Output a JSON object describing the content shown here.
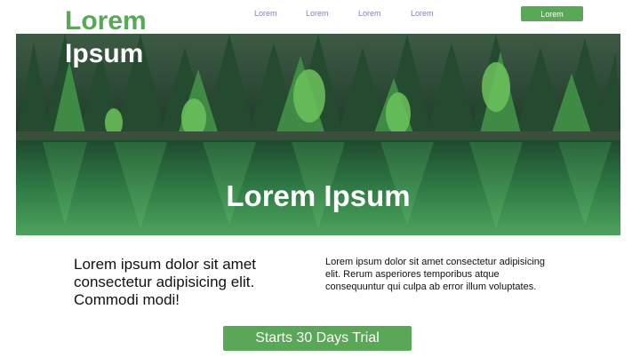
{
  "header": {
    "logo_line1": "Lorem",
    "logo_line2": "Ipsum",
    "nav": [
      "Lorem",
      "Lorem",
      "Lorem",
      "Lorem"
    ],
    "cta_label": "Lorem"
  },
  "hero": {
    "title": "Lorem Ipsum"
  },
  "content": {
    "lead": "Lorem ipsum dolor sit amet consectetur adipisicing elit. Commodi modi!",
    "body": "Lorem ipsum dolor sit amet consectetur adipisicing elit. Rerum asperiores temporibus atque consequuntur qui culpa ab error illum voluptates."
  },
  "cta": {
    "label": "Starts 30 Days Trial"
  },
  "colors": {
    "accent": "#5aa857",
    "nav_link": "#7b7fd6"
  }
}
